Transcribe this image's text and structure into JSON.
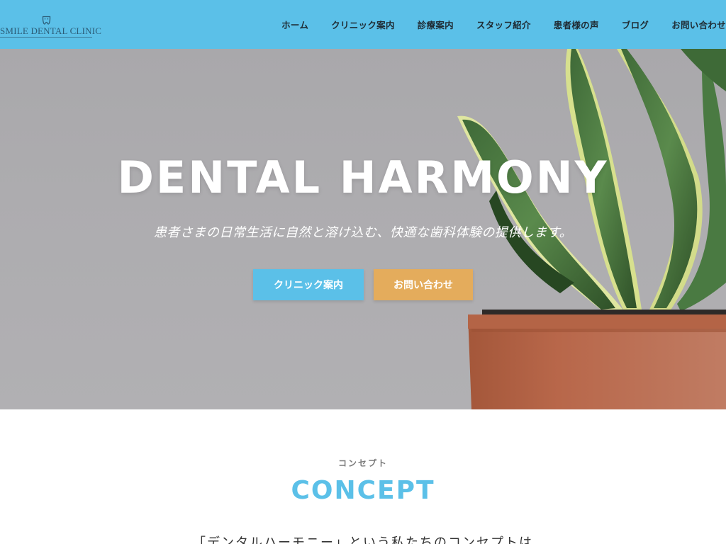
{
  "header": {
    "logo_text": "SMILE DENTAL CLINIC",
    "bg_color": "#5bc0e8",
    "nav": [
      {
        "label": "ホーム"
      },
      {
        "label": "クリニック案内"
      },
      {
        "label": "診療案内"
      },
      {
        "label": "スタッフ紹介"
      },
      {
        "label": "患者様の声"
      },
      {
        "label": "ブログ"
      },
      {
        "label": "お問い合わせ"
      }
    ]
  },
  "hero": {
    "title": "DENTAL HARMONY",
    "subtitle": "患者さまの日常生活に自然と溶け込む、快適な歯科体験の提供します。",
    "buttons": {
      "clinic_label": "クリニック案内",
      "clinic_color": "#5bc0e8",
      "contact_label": "お問い合わせ",
      "contact_color": "#e4ac5c"
    }
  },
  "concept": {
    "kana": "コンセプト",
    "title": "CONCEPT",
    "text": "「デンタルハーモニー」という私たちのコンセプトは"
  }
}
